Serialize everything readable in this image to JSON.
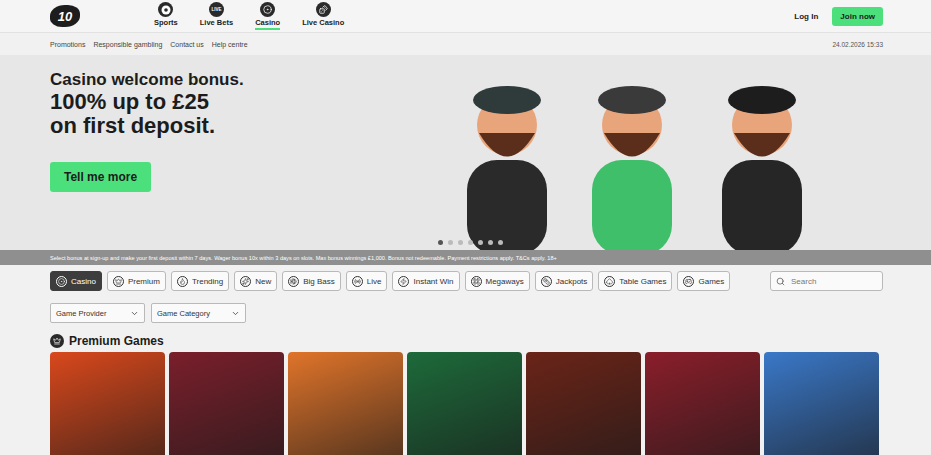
{
  "header": {
    "logo": "10",
    "nav": [
      {
        "label": "Sports",
        "selected": false
      },
      {
        "label": "Live Bets",
        "selected": false,
        "badge": "LIVE"
      },
      {
        "label": "Casino",
        "selected": true
      },
      {
        "label": "Live Casino",
        "selected": false
      }
    ],
    "login": "Log In",
    "join": "Join now"
  },
  "subnav": {
    "links": [
      "Promotions",
      "Responsible gambling",
      "Contact us",
      "Help centre"
    ],
    "timestamp": "24.02.2026 15:33"
  },
  "hero": {
    "kicker": "Casino welcome bonus.",
    "headline": [
      "100% up to £25",
      "on first deposit."
    ],
    "button": "Tell me more",
    "slides": [
      {
        "selected": true
      },
      {
        "selected": false
      },
      {
        "selected": false
      },
      {
        "selected": false
      },
      {
        "selected": false
      },
      {
        "selected": false
      },
      {
        "selected": false
      }
    ],
    "terms": "Select bonus at sign-up and make your first deposit within 7 days. Wager bonus 10x within 3 days on slots. Max bonus winnings £1,000. Bonus not redeemable. Payment restrictions apply. T&Cs apply. 18+"
  },
  "categories": [
    {
      "label": "Casino",
      "selected": true
    },
    {
      "label": "Premium",
      "selected": false
    },
    {
      "label": "Trending",
      "selected": false
    },
    {
      "label": "New",
      "selected": false
    },
    {
      "label": "Big Bass",
      "selected": false
    },
    {
      "label": "Live",
      "selected": false
    },
    {
      "label": "Instant Win",
      "selected": false
    },
    {
      "label": "Megaways",
      "selected": false
    },
    {
      "label": "Jackpots",
      "selected": false
    },
    {
      "label": "Table Games",
      "selected": false
    },
    {
      "label": "Games",
      "selected": false
    }
  ],
  "search": {
    "placeholder": "Search"
  },
  "filters": [
    "Game Provider",
    "Game Category"
  ],
  "section": {
    "title": "Premium Games"
  },
  "games": [
    {
      "color": "#d9481c"
    },
    {
      "color": "#7a1f2b"
    },
    {
      "color": "#e0742a"
    },
    {
      "color": "#1d6a3a"
    },
    {
      "color": "#6b2418"
    },
    {
      "color": "#8a1e2a"
    },
    {
      "color": "#3a78c8"
    }
  ]
}
